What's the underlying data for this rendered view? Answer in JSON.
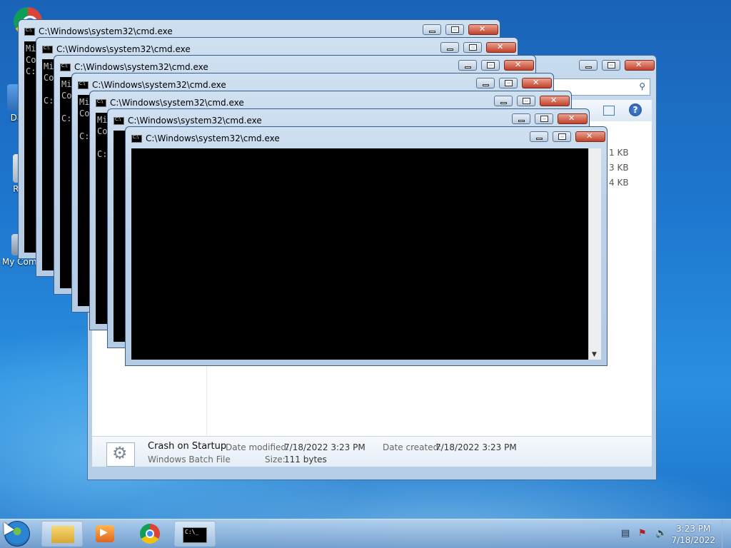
{
  "desktop": {
    "icons": [
      {
        "label": "Google Chrome",
        "partial": "G\nC"
      },
      {
        "label": "Data",
        "partial": "Data"
      },
      {
        "label": "Recycle Bin",
        "partial": "Rec"
      },
      {
        "label": "My Computer",
        "partial": "My Comp"
      }
    ]
  },
  "explorer": {
    "sizes": [
      "1 KB",
      "3 KB",
      "4 KB"
    ],
    "details": {
      "name": "Crash on Startup",
      "type": "Windows Batch File",
      "date_modified_label": "Date modified:",
      "date_modified": "7/18/2022 3:23 PM",
      "date_created_label": "Date created:",
      "date_created": "7/18/2022 3:23 PM",
      "size_label": "Size:",
      "size": "111 bytes"
    }
  },
  "cmd_windows": {
    "title": "C:\\Windows\\system32\\cmd.exe",
    "console_lines": [
      "Mi",
      "Co",
      "",
      "C:"
    ]
  },
  "taskbar": {
    "clock_time": "3:23 PM",
    "clock_date": "7/18/2022"
  }
}
